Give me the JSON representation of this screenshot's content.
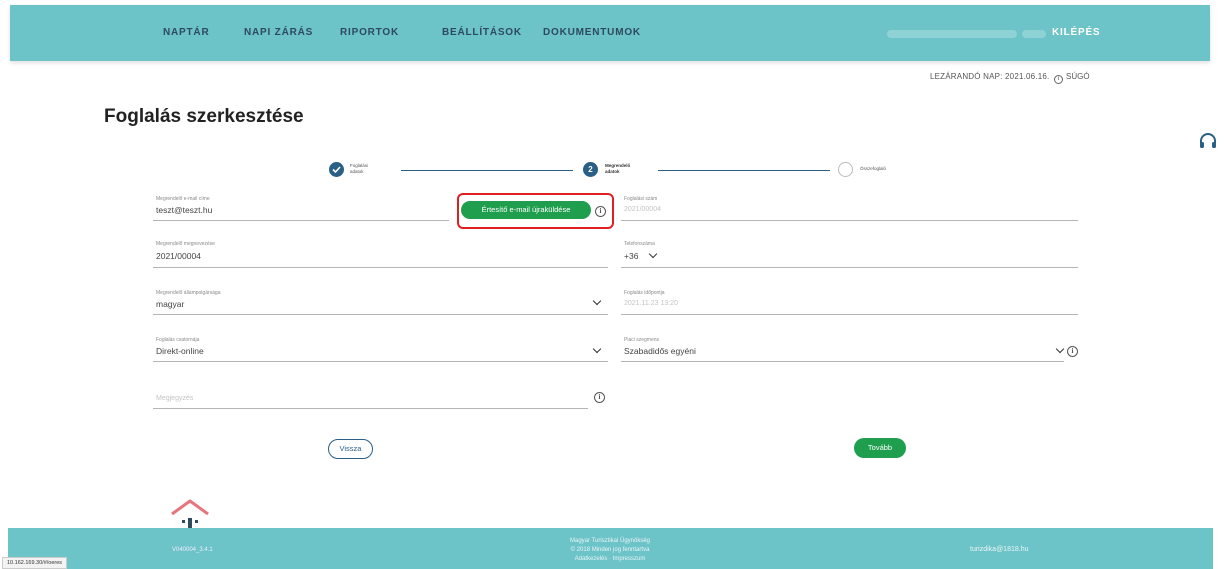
{
  "nav": {
    "items": [
      "NAPTÁR",
      "NAPI ZÁRÁS",
      "RIPORTOK",
      "BEÁLLÍTÁSOK",
      "DOKUMENTUMOK"
    ],
    "logout_label": "KILÉPÉS"
  },
  "topline": {
    "closing_day": "LEZÁRANDÓ NAP: 2021.06.16.",
    "help_label": "SÚGÓ"
  },
  "page_title": "Foglalás szerkesztése",
  "stepper": {
    "step1_label_line1": "Foglalási",
    "step1_label_line2": "adatok",
    "step2_number": "2",
    "step2_label_line1": "Megrendelő",
    "step2_label_line2": "adatok",
    "step3_label": "Összefoglaló"
  },
  "form": {
    "email_label": "Megrendelő e-mail címe",
    "email_value": "teszt@teszt.hu",
    "resend_button": "Értesítő e-mail újraküldése",
    "booking_number_label": "Foglalási szám",
    "booking_number_value": "2021/00004",
    "order_name_label": "Megrendelő megnevezése",
    "order_name_value": "2021/00004",
    "phone_label": "Telefonszáma",
    "phone_prefix": "+36",
    "citizenship_label": "Megrendelő állampolgársága",
    "citizenship_value": "magyar",
    "booking_time_label": "Foglalás időpontja",
    "booking_time_value": "2021.11.23 13:20",
    "channel_label": "Foglalás csatornája",
    "channel_value": "Direkt-online",
    "segment_label": "Piaci szegmens",
    "segment_value": "Szabadidős egyéni",
    "note_placeholder": "Megjegyzés"
  },
  "buttons": {
    "back": "Vissza",
    "next": "Tovább"
  },
  "footer": {
    "version": "V040004_3.4.1",
    "line1": "Magyar Turisztikai Ügynökség",
    "line2": "© 2018 Minden jog fenntartva",
    "line3": "Adatkezelés · Impresszum",
    "email": "turizdika@1818.hu"
  },
  "status_url": "10.162.169.30/#/oeres",
  "colors": {
    "header_bg": "#6cc3c8",
    "primary_green": "#1f9e4e",
    "step_blue": "#2a5f86",
    "highlight_red": "#e02020"
  }
}
